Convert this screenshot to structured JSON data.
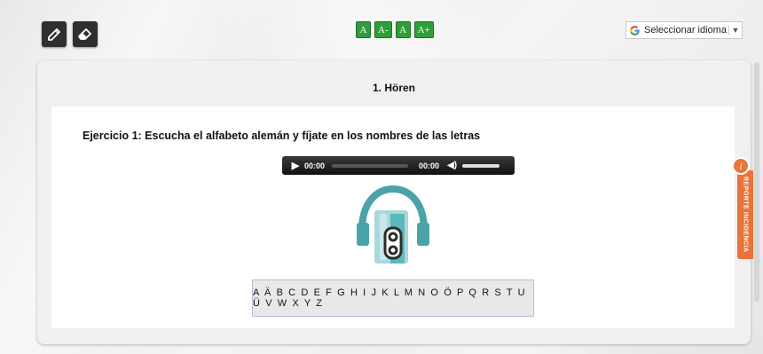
{
  "toolbar": {
    "pencil_icon": "pencil-icon",
    "eraser_icon": "eraser-icon"
  },
  "font_controls": [
    "A",
    "A-",
    "A",
    "A+"
  ],
  "language": {
    "icon": "google-g-icon",
    "label": "Seleccionar idioma",
    "arrow": "▼"
  },
  "section": {
    "title": "1. Hören"
  },
  "exercise": {
    "title": "Ejercicio 1: Escucha el alfabeto alemán y fíjate en los nombres de las letras"
  },
  "audio": {
    "current_time": "00:00",
    "duration": "00:00",
    "volume_level": 1.0
  },
  "alphabet": "A Ä B C D E F G H I J K L M N O Ö P Q R S T U Ü V W X Y Z",
  "report": {
    "label": "REPORTE INCIDENCIA",
    "icon_glyph": "i"
  },
  "colors": {
    "font_button": "#2e9e3a",
    "report_tab": "#e8743a",
    "headphone_teal": "#4aa3a6"
  }
}
